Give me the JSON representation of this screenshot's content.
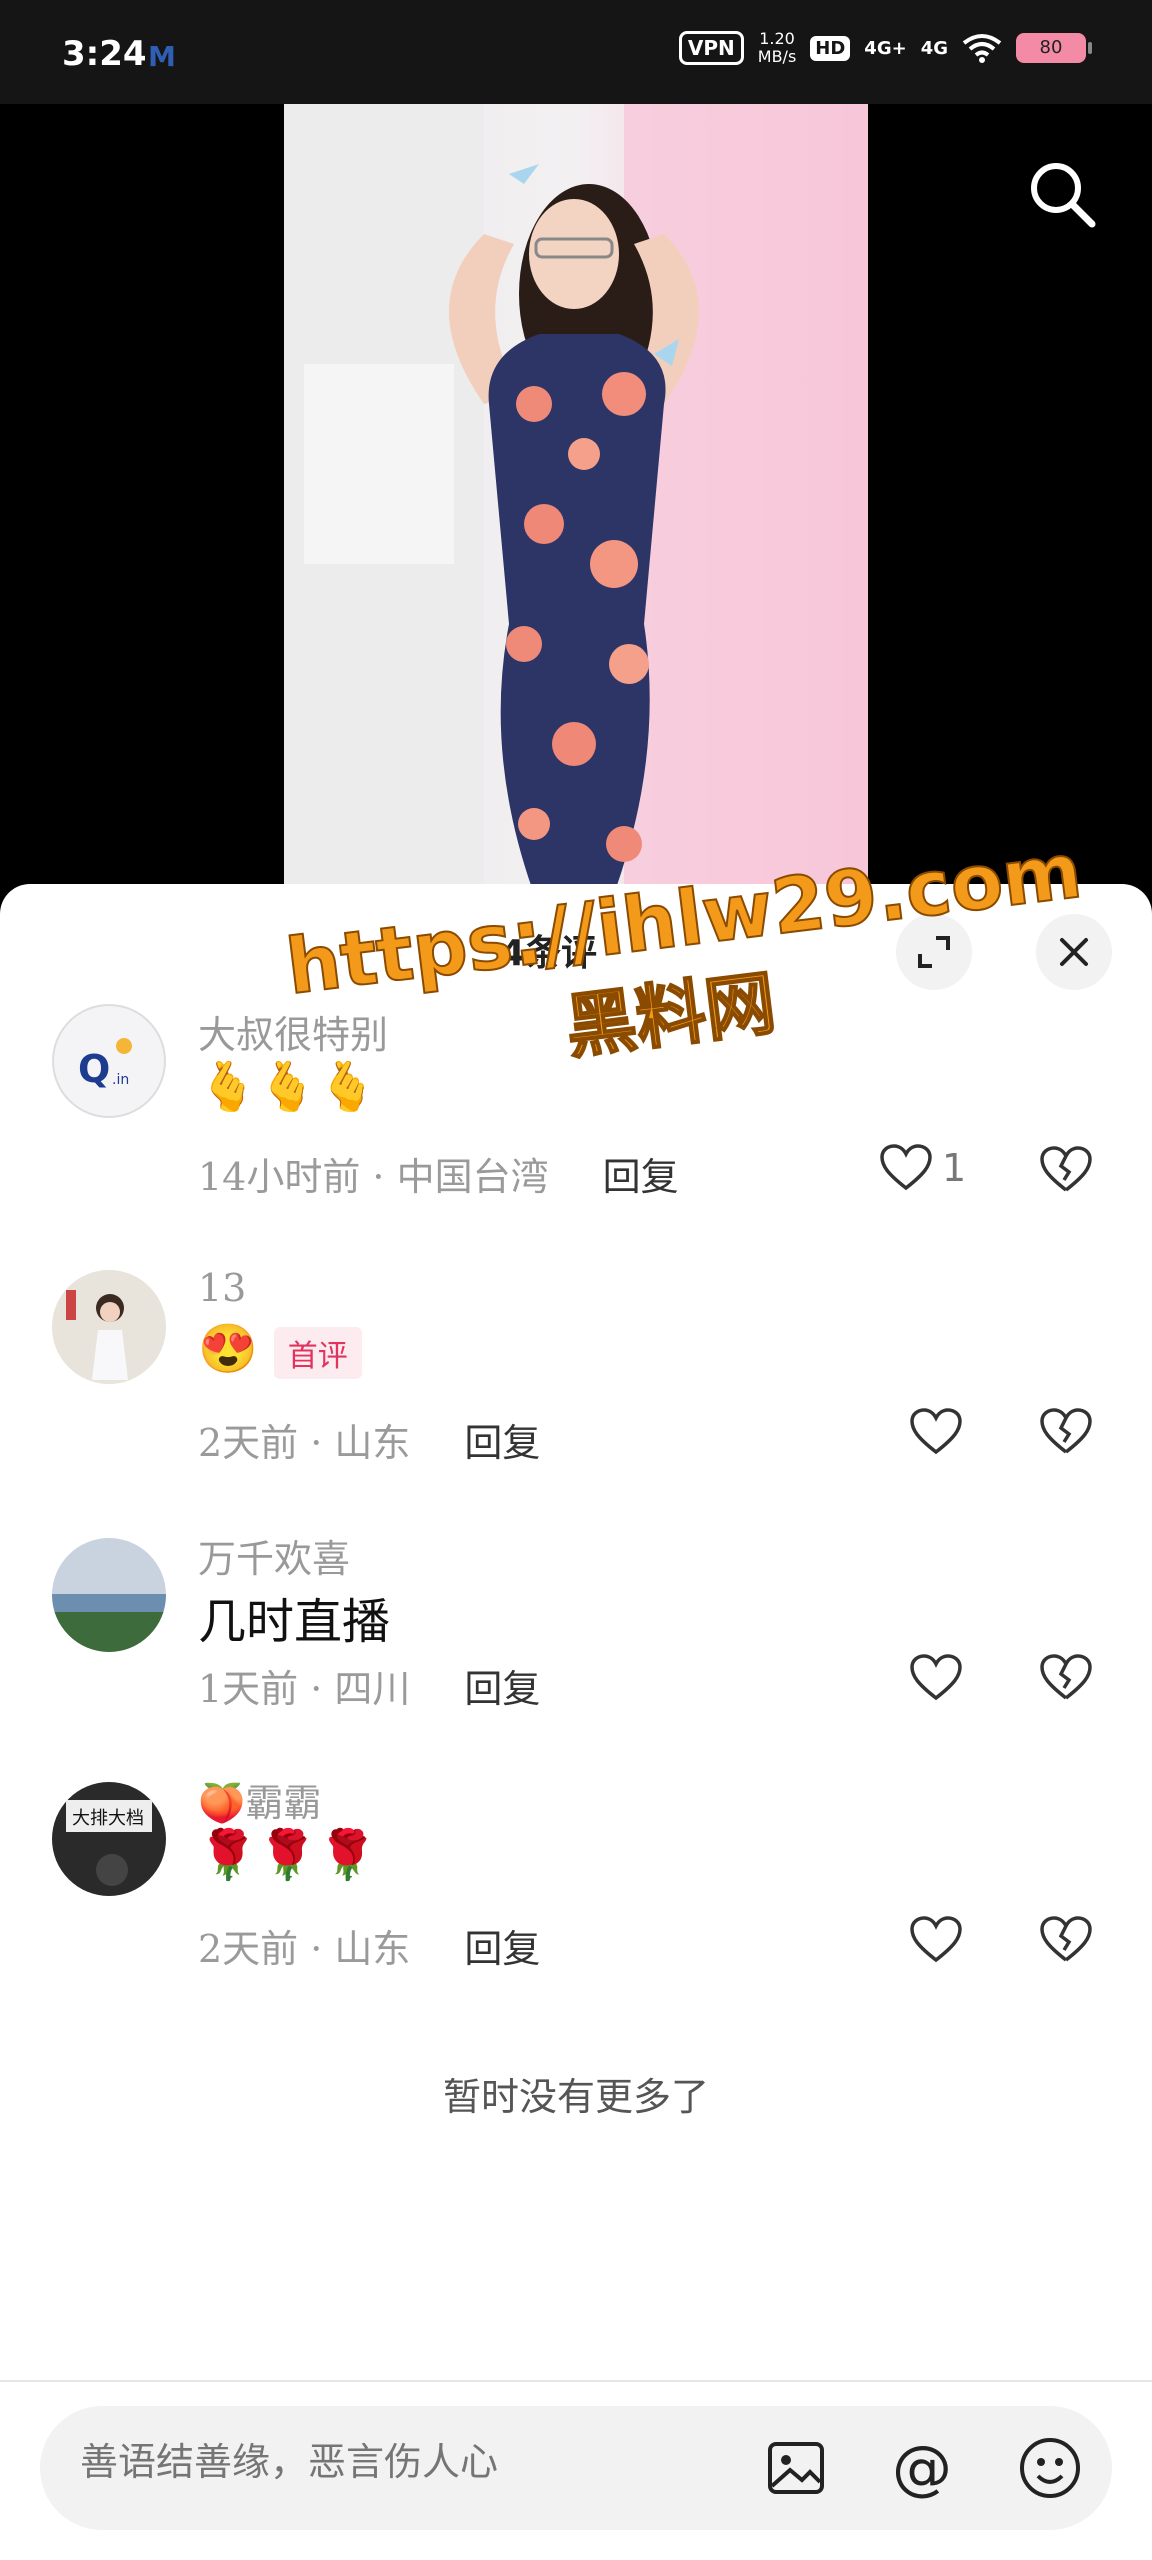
{
  "status": {
    "time": "3:24",
    "app_icon_label": "M",
    "vpn": "VPN",
    "speed_value": "1.20",
    "speed_unit": "MB/s",
    "hd": "HD",
    "net1": "4G+",
    "net2": "4G",
    "battery": "80"
  },
  "video": {
    "search_icon": "search-icon"
  },
  "sheet": {
    "count": "4条评",
    "expand_icon": "expand-icon",
    "close_icon": "close-icon"
  },
  "watermark": {
    "url": "https://ihlw29.com",
    "name": "黑料网"
  },
  "comments": [
    {
      "name": "大叔很特别",
      "body": "🫰🫰🫰",
      "time": "14小时前 · 中国台湾",
      "reply": "回复",
      "likes": "1"
    },
    {
      "name": "13",
      "body": "😍",
      "badge": "首评",
      "time": "2天前 · 山东",
      "reply": "回复",
      "likes": ""
    },
    {
      "name": "万千欢喜",
      "body": "几时直播",
      "time": "1天前 · 四川",
      "reply": "回复",
      "likes": ""
    },
    {
      "name": "🍑霸霸",
      "body": "🌹🌹🌹",
      "time": "2天前 · 山东",
      "reply": "回复",
      "likes": ""
    }
  ],
  "no_more": "暂时没有更多了",
  "input": {
    "placeholder": "善语结善缘，恶言伤人心"
  },
  "colors": {
    "accent_badge": "#e0345f",
    "watermark": "#f39a1a"
  }
}
